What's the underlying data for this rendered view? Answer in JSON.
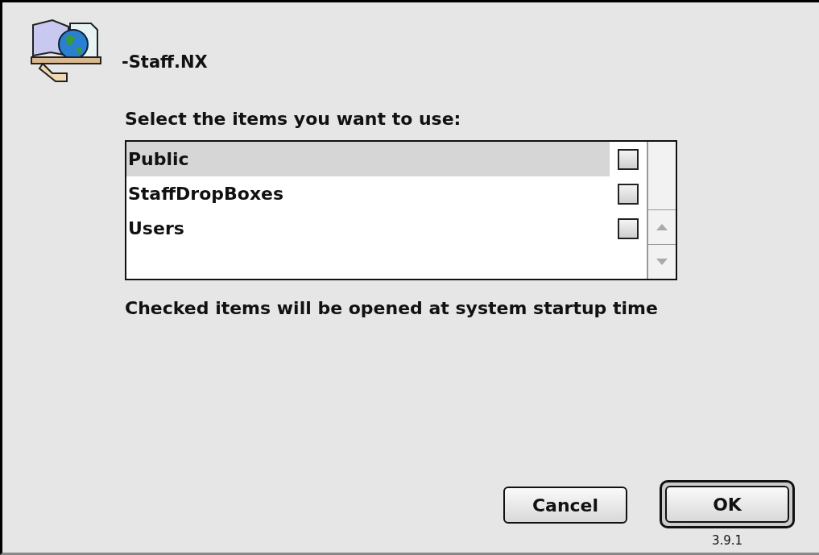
{
  "dialog": {
    "title": "-Staff.NX",
    "prompt": "Select the items you want to use:",
    "items": [
      {
        "label": "Public",
        "selected": true,
        "checked": false
      },
      {
        "label": "StaffDropBoxes",
        "selected": false,
        "checked": false
      },
      {
        "label": "Users",
        "selected": false,
        "checked": false
      }
    ],
    "note": "Checked items will be opened at system startup time",
    "buttons": [
      {
        "label": "Cancel",
        "default": false
      },
      {
        "label": "OK",
        "default": true
      }
    ],
    "version": "3.9.1"
  }
}
